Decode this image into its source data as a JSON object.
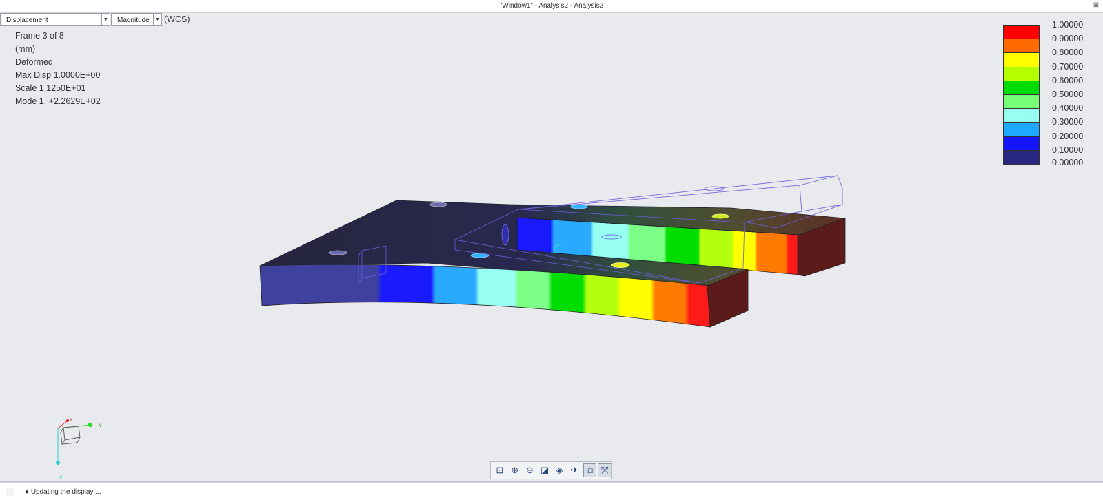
{
  "window": {
    "title": "\"Window1\" - Analysis2 - Analysis2",
    "close_glyph": "⊠"
  },
  "toolbar_top": {
    "quantity": "Displacement",
    "component": "Magnitude",
    "coord_system": "(WCS)"
  },
  "info": {
    "frame": "Frame 3 of 8",
    "units": "(mm)",
    "state": "Deformed",
    "max_disp": "Max Disp  1.0000E+00",
    "scale": "Scale  1.1250E+01",
    "mode": "Mode 1,  +2.2629E+02"
  },
  "legend": {
    "items": [
      {
        "color": "#ff0000",
        "value": "1.00000"
      },
      {
        "color": "#ff6a00",
        "value": "0.90000"
      },
      {
        "color": "#ffff00",
        "value": "0.80000"
      },
      {
        "color": "#b4ff00",
        "value": "0.70000"
      },
      {
        "color": "#00dc00",
        "value": "0.60000"
      },
      {
        "color": "#78ff78",
        "value": "0.50000"
      },
      {
        "color": "#96fff0",
        "value": "0.40000"
      },
      {
        "color": "#1ea8ff",
        "value": "0.30000"
      },
      {
        "color": "#1414ff",
        "value": "0.20000"
      },
      {
        "color": "#282880",
        "value": "0.10000"
      }
    ],
    "last_value": "0.00000"
  },
  "triad": {
    "x_label": "X",
    "y_label": "Y",
    "z_label": "Z"
  },
  "view_toolbar": [
    {
      "icon": "zoom-fit-icon",
      "glyph": "⊡",
      "active": false
    },
    {
      "icon": "zoom-in-icon",
      "glyph": "⊕",
      "active": false
    },
    {
      "icon": "zoom-out-icon",
      "glyph": "⊖",
      "active": false
    },
    {
      "icon": "shade-icon",
      "glyph": "◪",
      "active": false
    },
    {
      "icon": "view-orient-icon",
      "glyph": "◈",
      "active": false
    },
    {
      "icon": "spin-center-icon",
      "glyph": "✈",
      "active": false
    },
    {
      "icon": "datum-display-icon",
      "glyph": "⧉",
      "active": true
    },
    {
      "icon": "csys-display-icon",
      "glyph": "⤱",
      "active": true
    }
  ],
  "status": {
    "message": "Updating the display ..."
  }
}
